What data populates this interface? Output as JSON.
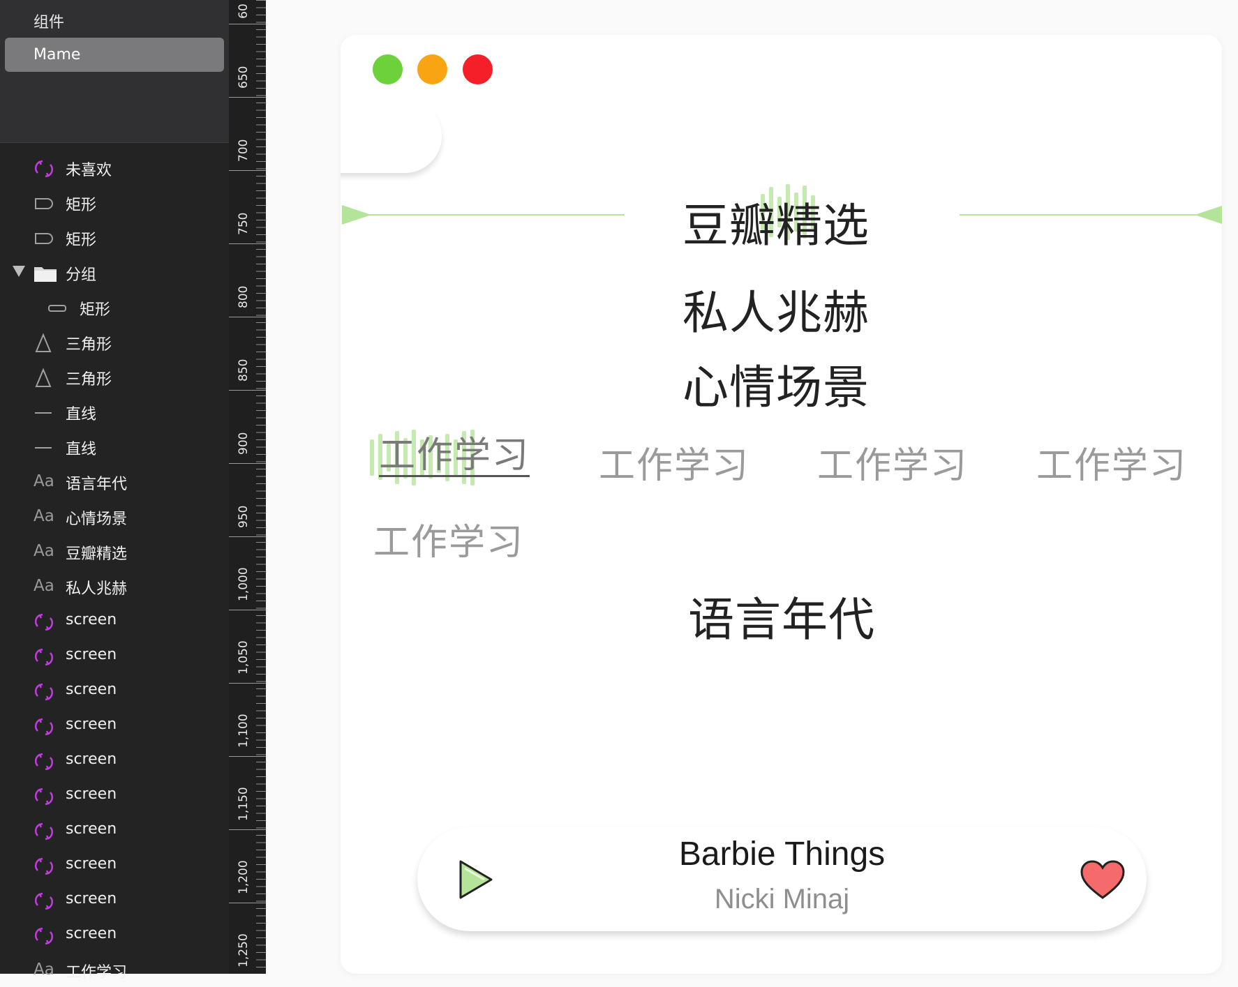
{
  "sidebar": {
    "components_title": "组件",
    "selected_item": "Mame",
    "layers": [
      {
        "icon": "symbol-icon",
        "label": "未喜欢"
      },
      {
        "icon": "rectangle-icon",
        "label": "矩形"
      },
      {
        "icon": "rectangle-icon",
        "label": "矩形"
      },
      {
        "icon": "folder-icon",
        "label": "分组"
      },
      {
        "icon": "rectangle-icon",
        "label": "矩形"
      },
      {
        "icon": "triangle-icon",
        "label": "三角形"
      },
      {
        "icon": "triangle-icon",
        "label": "三角形"
      },
      {
        "icon": "line-icon",
        "label": "直线"
      },
      {
        "icon": "line-icon",
        "label": "直线"
      },
      {
        "icon": "text-icon",
        "label": "语言年代"
      },
      {
        "icon": "text-icon",
        "label": "心情场景"
      },
      {
        "icon": "text-icon",
        "label": "豆瓣精选"
      },
      {
        "icon": "text-icon",
        "label": "私人兆赫"
      },
      {
        "icon": "symbol-icon",
        "label": "screen"
      },
      {
        "icon": "symbol-icon",
        "label": "screen"
      },
      {
        "icon": "symbol-icon",
        "label": "screen"
      },
      {
        "icon": "symbol-icon",
        "label": "screen"
      },
      {
        "icon": "symbol-icon",
        "label": "screen"
      },
      {
        "icon": "symbol-icon",
        "label": "screen"
      },
      {
        "icon": "symbol-icon",
        "label": "screen"
      },
      {
        "icon": "symbol-icon",
        "label": "screen"
      },
      {
        "icon": "symbol-icon",
        "label": "screen"
      },
      {
        "icon": "symbol-icon",
        "label": "screen"
      },
      {
        "icon": "text-icon",
        "label": "工作学习"
      }
    ]
  },
  "ruler": {
    "labels": [
      "60",
      "650",
      "700",
      "750",
      "800",
      "850",
      "900",
      "950",
      "1,000",
      "1,050",
      "1,100",
      "1,150",
      "1,200",
      "1,250"
    ]
  },
  "window": {
    "traffic_lights": {
      "green": "#6dd13c",
      "yellow": "#f9a513",
      "red": "#f51f2a"
    },
    "categories": {
      "douban": "豆瓣精选",
      "private": "私人兆赫",
      "mood": "心情场景",
      "language": "语言年代"
    },
    "tags": [
      "工作学习",
      "工作学习",
      "工作学习",
      "工作学习",
      "工作学习"
    ],
    "accent_color": "#b4e49a",
    "player": {
      "song": "Barbie Things",
      "artist": "Nicki Minaj",
      "play_icon": "play-icon",
      "like_icon": "heart-icon"
    }
  }
}
